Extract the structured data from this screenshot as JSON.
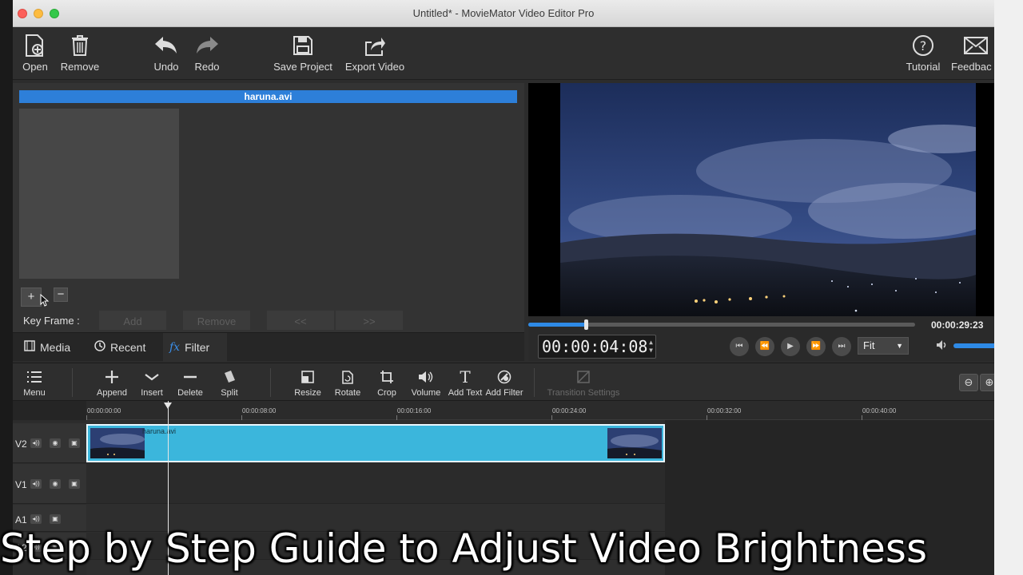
{
  "window": {
    "title": "Untitled* - MovieMator Video Editor Pro"
  },
  "toolbar": {
    "open": "Open",
    "remove": "Remove",
    "undo": "Undo",
    "redo": "Redo",
    "save_project": "Save Project",
    "export_video": "Export Video",
    "tutorial": "Tutorial",
    "feedback": "Feedbac"
  },
  "filter_panel": {
    "clip_name": "haruna.avi",
    "add_filter_symbol": "+",
    "remove_filter_symbol": "−",
    "key_frame_label": "Key Frame :",
    "kf_add": "Add",
    "kf_remove": "Remove",
    "kf_prev": "<<",
    "kf_next": ">>"
  },
  "tabs": {
    "media": "Media",
    "recent": "Recent",
    "filter": "Filter",
    "filter_icon": "fx"
  },
  "preview": {
    "total_time": "00:00:29:23",
    "current_time": "00:00:04:08",
    "zoom": "Fit",
    "progress_fraction": 0.149
  },
  "timeline_toolbar": {
    "menu": "Menu",
    "append": "Append",
    "insert": "Insert",
    "delete": "Delete",
    "split": "Split",
    "resize": "Resize",
    "rotate": "Rotate",
    "crop": "Crop",
    "volume": "Volume",
    "add_text": "Add Text",
    "add_filter": "Add Filter",
    "transition_settings": "Transition Settings",
    "text_icon": "T"
  },
  "timeline": {
    "ruler": [
      "00:00:00:00",
      "00:00:08:00",
      "00:00:16:00",
      "00:00:24:00",
      "00:00:32:00",
      "00:00:40:00"
    ],
    "tracks": {
      "v2": "V2",
      "v1": "V1",
      "a1": "A1",
      "a2": "A2"
    },
    "clip_label": "haruna.avi"
  },
  "caption": "Step by Step Guide to Adjust Video Brightness",
  "colors": {
    "accent": "#2d7fd9",
    "clip": "#3bb6dc",
    "panel": "#333333"
  }
}
